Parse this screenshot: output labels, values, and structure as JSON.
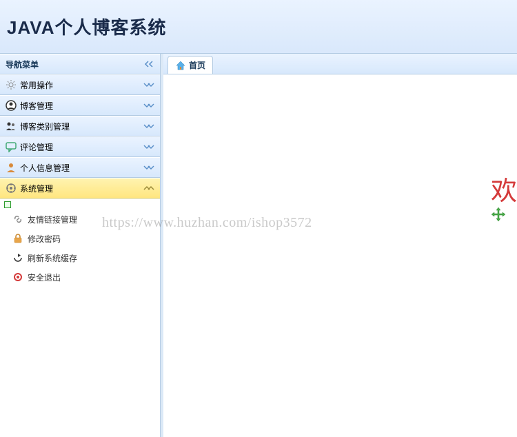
{
  "header": {
    "title": "JAVA个人博客系统"
  },
  "sidebar": {
    "title": "导航菜单",
    "panels": [
      {
        "label": "常用操作",
        "expanded": false
      },
      {
        "label": "博客管理",
        "expanded": false
      },
      {
        "label": "博客类别管理",
        "expanded": false
      },
      {
        "label": "评论管理",
        "expanded": false
      },
      {
        "label": "个人信息管理",
        "expanded": false
      },
      {
        "label": "系统管理",
        "expanded": true,
        "items": [
          {
            "label": "友情链接管理"
          },
          {
            "label": "修改密码"
          },
          {
            "label": "刷新系统缓存"
          },
          {
            "label": "安全退出"
          }
        ]
      }
    ]
  },
  "tabs": {
    "home": "首页"
  },
  "content": {
    "welcome": "欢"
  },
  "watermark": "https://www.huzhan.com/ishop3572"
}
